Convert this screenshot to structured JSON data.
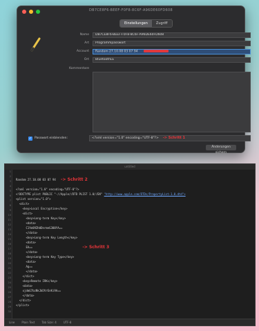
{
  "dialog": {
    "title": "DB7CE8F6-BEEF-F0F8-8C6F-A96DE60FD608",
    "tabs": [
      "Einstellungen",
      "Zugriff"
    ],
    "fields": [
      {
        "label": "Name",
        "value": "DB7CE8F6-BEEF-F0F8-8C6F-A96DE60FD608"
      },
      {
        "label": "Art",
        "value": "Programmpasswort"
      },
      {
        "label": "Account",
        "value": "Random 27.10.08 03 07 94"
      },
      {
        "label": "Ort",
        "value": "BluetoothLE"
      }
    ],
    "kommentare_label": "Kommentare",
    "show_password_label": "Passwort einblenden:",
    "plist_value": "<?xml version=\"1.0\" encoding=\"UTF-8\"?>",
    "annotation": "-> Schritt 1",
    "button": "Änderungen sichern"
  },
  "editor": {
    "title": "untitled",
    "line_numbers": [
      "1",
      "2",
      "3",
      "4",
      "5",
      "6",
      "7",
      "8",
      "9",
      "10",
      "11",
      "12",
      "13",
      "14",
      "15",
      "16",
      "17",
      "18",
      "19",
      "20",
      "21",
      "22",
      "23",
      "24",
      "25",
      "26",
      "27",
      "28",
      "29",
      "30"
    ],
    "lines": [
      "Random 27.10.08 03 07 94",
      "",
      "<?xml version=\"1.0\" encoding=\"UTF-8\"?>",
      "<!DOCTYPE plist PUBLIC \"-//Apple//DTD PLIST 1.0//EN\" ",
      "<plist version=\"1.0\">",
      "  <dict>",
      "    <key>Local Encryption</key>",
      "    <dict>",
      "      <key>Long-term Key</key>",
      "      <data>",
      "      C1Ym09ZHdDnrmeG300YA==",
      "      </data>",
      "      <key>Long-term Key Length</key>",
      "      <data>",
      "      EA==",
      "      </data>",
      "      <key>Long-term Key Type</key>",
      "      <data>",
      "      Ag==",
      "      </data>",
      "    </dict>",
      "    <key>Remote IRK</key>",
      "    <data>",
      "    xjdmG7bzNkJWJVrEnKi9A==",
      "    </data>",
      "  </dict>",
      "</plist>"
    ],
    "doctype_link": "\"http://www.apple.com/DTDs/PropertyList-1.0.dtd\">",
    "annotation2": "-> Schritt 2",
    "annotation3": "-> Schritt 3",
    "status": [
      "Line",
      "Plain Text",
      "Tab Size: 4",
      "UTF-8"
    ]
  }
}
